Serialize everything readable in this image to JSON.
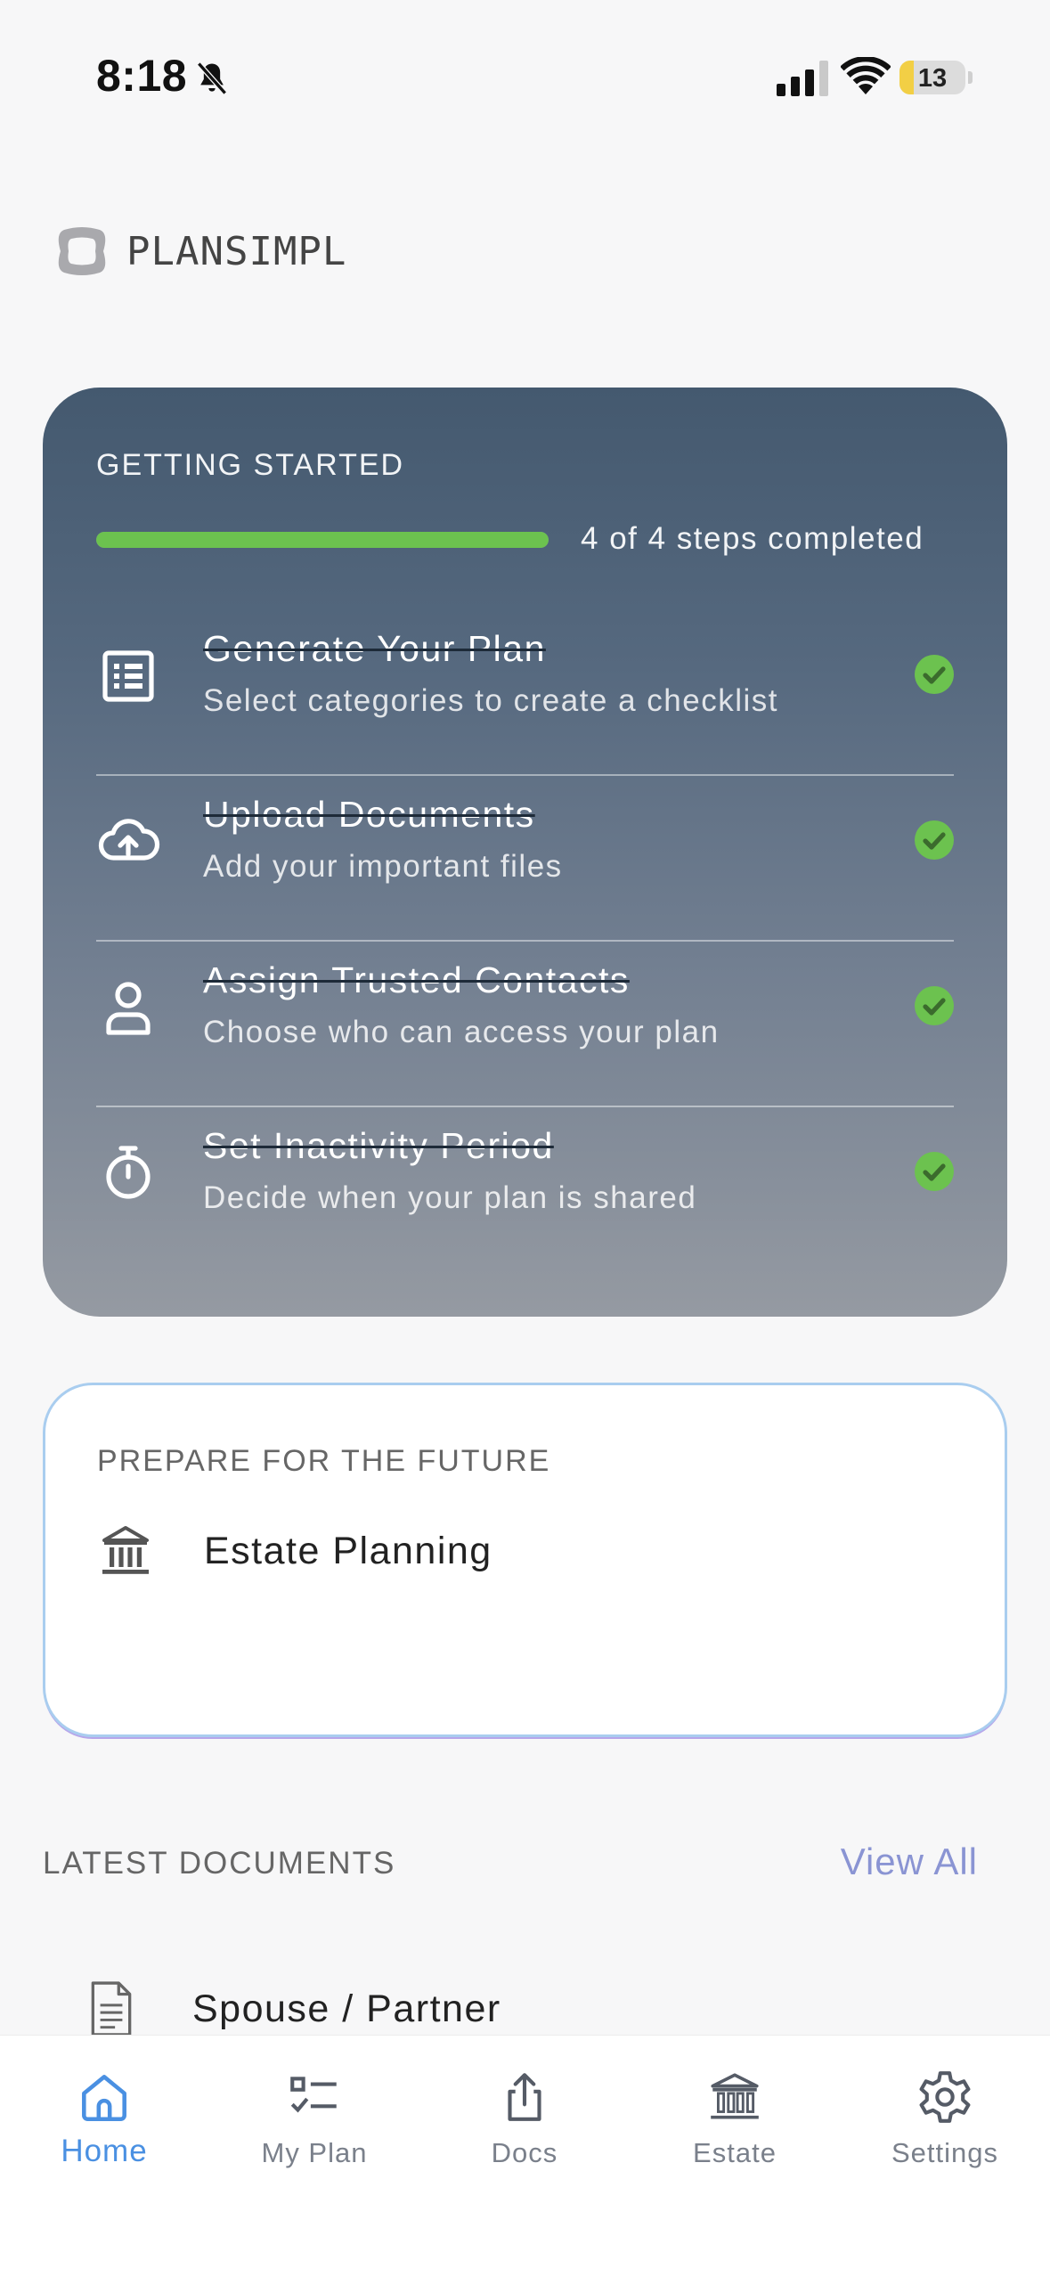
{
  "status_bar": {
    "time": "8:18",
    "battery": "13"
  },
  "brand": {
    "name": "PLANSIMPL"
  },
  "getting_started": {
    "title": "GETTING STARTED",
    "progress": {
      "completed": 4,
      "total": 4,
      "fraction": 1.0,
      "text": "4 of 4 steps completed"
    },
    "steps": [
      {
        "title": "Generate Your Plan",
        "subtitle": "Select categories to create a checklist",
        "icon": "checklist-icon",
        "done": true
      },
      {
        "title": "Upload Documents",
        "subtitle": "Add your important files",
        "icon": "cloud-upload-icon",
        "done": true
      },
      {
        "title": "Assign Trusted Contacts",
        "subtitle": "Choose who can access your plan",
        "icon": "person-icon",
        "done": true
      },
      {
        "title": "Set Inactivity Period",
        "subtitle": "Decide when your plan is shared",
        "icon": "stopwatch-icon",
        "done": true
      }
    ]
  },
  "prepare": {
    "title": "PREPARE FOR THE FUTURE",
    "item": {
      "label": "Estate Planning",
      "icon": "bank-icon"
    }
  },
  "latest_documents": {
    "title": "LATEST DOCUMENTS",
    "view_all": "View All",
    "items": [
      {
        "label": "Spouse / Partner",
        "icon": "document-icon"
      }
    ]
  },
  "tab_bar": {
    "tabs": [
      {
        "label": "Home",
        "icon": "home-icon",
        "active": true
      },
      {
        "label": "My Plan",
        "icon": "list-check-icon",
        "active": false
      },
      {
        "label": "Docs",
        "icon": "share-upload-icon",
        "active": false
      },
      {
        "label": "Estate",
        "icon": "bank-icon",
        "active": false
      },
      {
        "label": "Settings",
        "icon": "gear-icon",
        "active": false
      }
    ]
  },
  "colors": {
    "progress_fill": "#6cc24f",
    "check": "#6cc24f",
    "active_tab": "#4a90e2",
    "inactive_tab": "#7a808b",
    "view_all": "#8a94d3"
  }
}
